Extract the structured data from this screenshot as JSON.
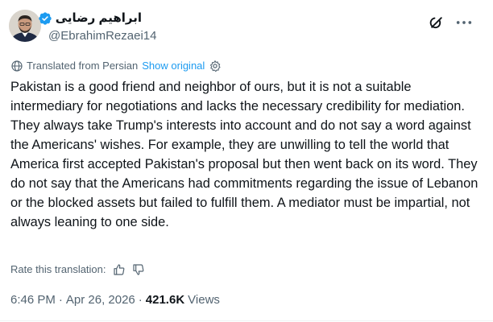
{
  "author": {
    "display_name": "ابراهیم رضایی",
    "handle": "@EbrahimRezaei14",
    "verified": true
  },
  "icons": {
    "avatar": "profile-photo",
    "verified": "verified-badge-icon",
    "grok": "grok-icon",
    "more": "more-options-icon",
    "translate": "globe-translate-icon",
    "settings": "gear-icon",
    "like": "thumbs-up-icon",
    "dislike": "thumbs-down-icon"
  },
  "translation": {
    "label": "Translated from Persian",
    "show_original": "Show original"
  },
  "tweet": {
    "text": "Pakistan is a good friend and neighbor of ours, but it is not a suitable intermediary for negotiations and lacks the necessary credibility for mediation. They always take Trump's interests into account and do not say a word against the Americans' wishes. For example, they are unwilling to tell the world that America first accepted Pakistan's proposal but then went back on its word. They do not say that the Americans had commitments regarding the issue of Lebanon or the blocked assets but failed to fulfill them. A mediator must be impartial, not always leaning to one side."
  },
  "rating": {
    "label": "Rate this translation:"
  },
  "meta": {
    "time": "6:46 PM",
    "separator": "·",
    "date": "Apr 26, 2026",
    "views_count": "421.6K",
    "views_label": "Views"
  },
  "colors": {
    "text": "#0f1419",
    "secondary": "#536471",
    "accent": "#1d9bf0"
  }
}
